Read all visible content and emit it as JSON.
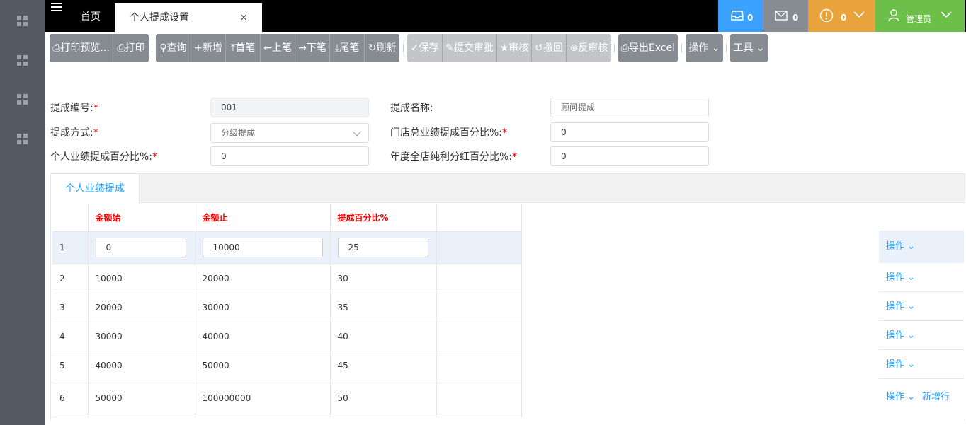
{
  "topbar": {
    "home_tab": "首页",
    "active_tab": "个人提成设置",
    "close_glyph": "×",
    "notify_count": "0",
    "mail_count": "0",
    "alert_count": "0",
    "user_label": "管理员",
    "colors": {
      "notify": "#3aa1ff",
      "mail": "#878c93",
      "alert": "#e8a33d",
      "user": "#6cc04a"
    }
  },
  "toolbar": {
    "print_preview": "打印预览...",
    "print": "打印",
    "query": "查询",
    "add": "新增",
    "first": "首笔",
    "prev": "上笔",
    "next": "下笔",
    "last": "尾笔",
    "refresh": "刷新",
    "save": "保存",
    "submit": "提交审批",
    "approve": "审核",
    "revoke": "撤回",
    "unapprove": "反审核",
    "export": "导出Excel",
    "operate": "操作",
    "tools": "工具"
  },
  "form": {
    "code_label": "提成编号:",
    "code_value": "001",
    "name_label": "提成名称:",
    "name_placeholder": "顾问提成",
    "method_label": "提成方式:",
    "method_value": "分级提成",
    "store_pct_label": "门店总业绩提成百分比%:",
    "store_pct_value": "0",
    "personal_pct_label": "个人业绩提成百分比%:",
    "personal_pct_value": "0",
    "annual_pct_label": "年度全店纯利分红百分比%:",
    "annual_pct_value": "0",
    "required_mark": "*"
  },
  "detail": {
    "tab_label": "个人业绩提成",
    "headers": [
      "金额始",
      "金额止",
      "提成百分比%"
    ],
    "rows": [
      {
        "no": "1",
        "from": "0",
        "to": "10000",
        "pct": "25"
      },
      {
        "no": "2",
        "from": "10000",
        "to": "20000",
        "pct": "30"
      },
      {
        "no": "3",
        "from": "20000",
        "to": "30000",
        "pct": "35"
      },
      {
        "no": "4",
        "from": "30000",
        "to": "40000",
        "pct": "40"
      },
      {
        "no": "5",
        "from": "40000",
        "to": "50000",
        "pct": "45"
      },
      {
        "no": "6",
        "from": "50000",
        "to": "100000000",
        "pct": "50"
      }
    ],
    "row_op": "操作",
    "add_row": "新增行"
  }
}
